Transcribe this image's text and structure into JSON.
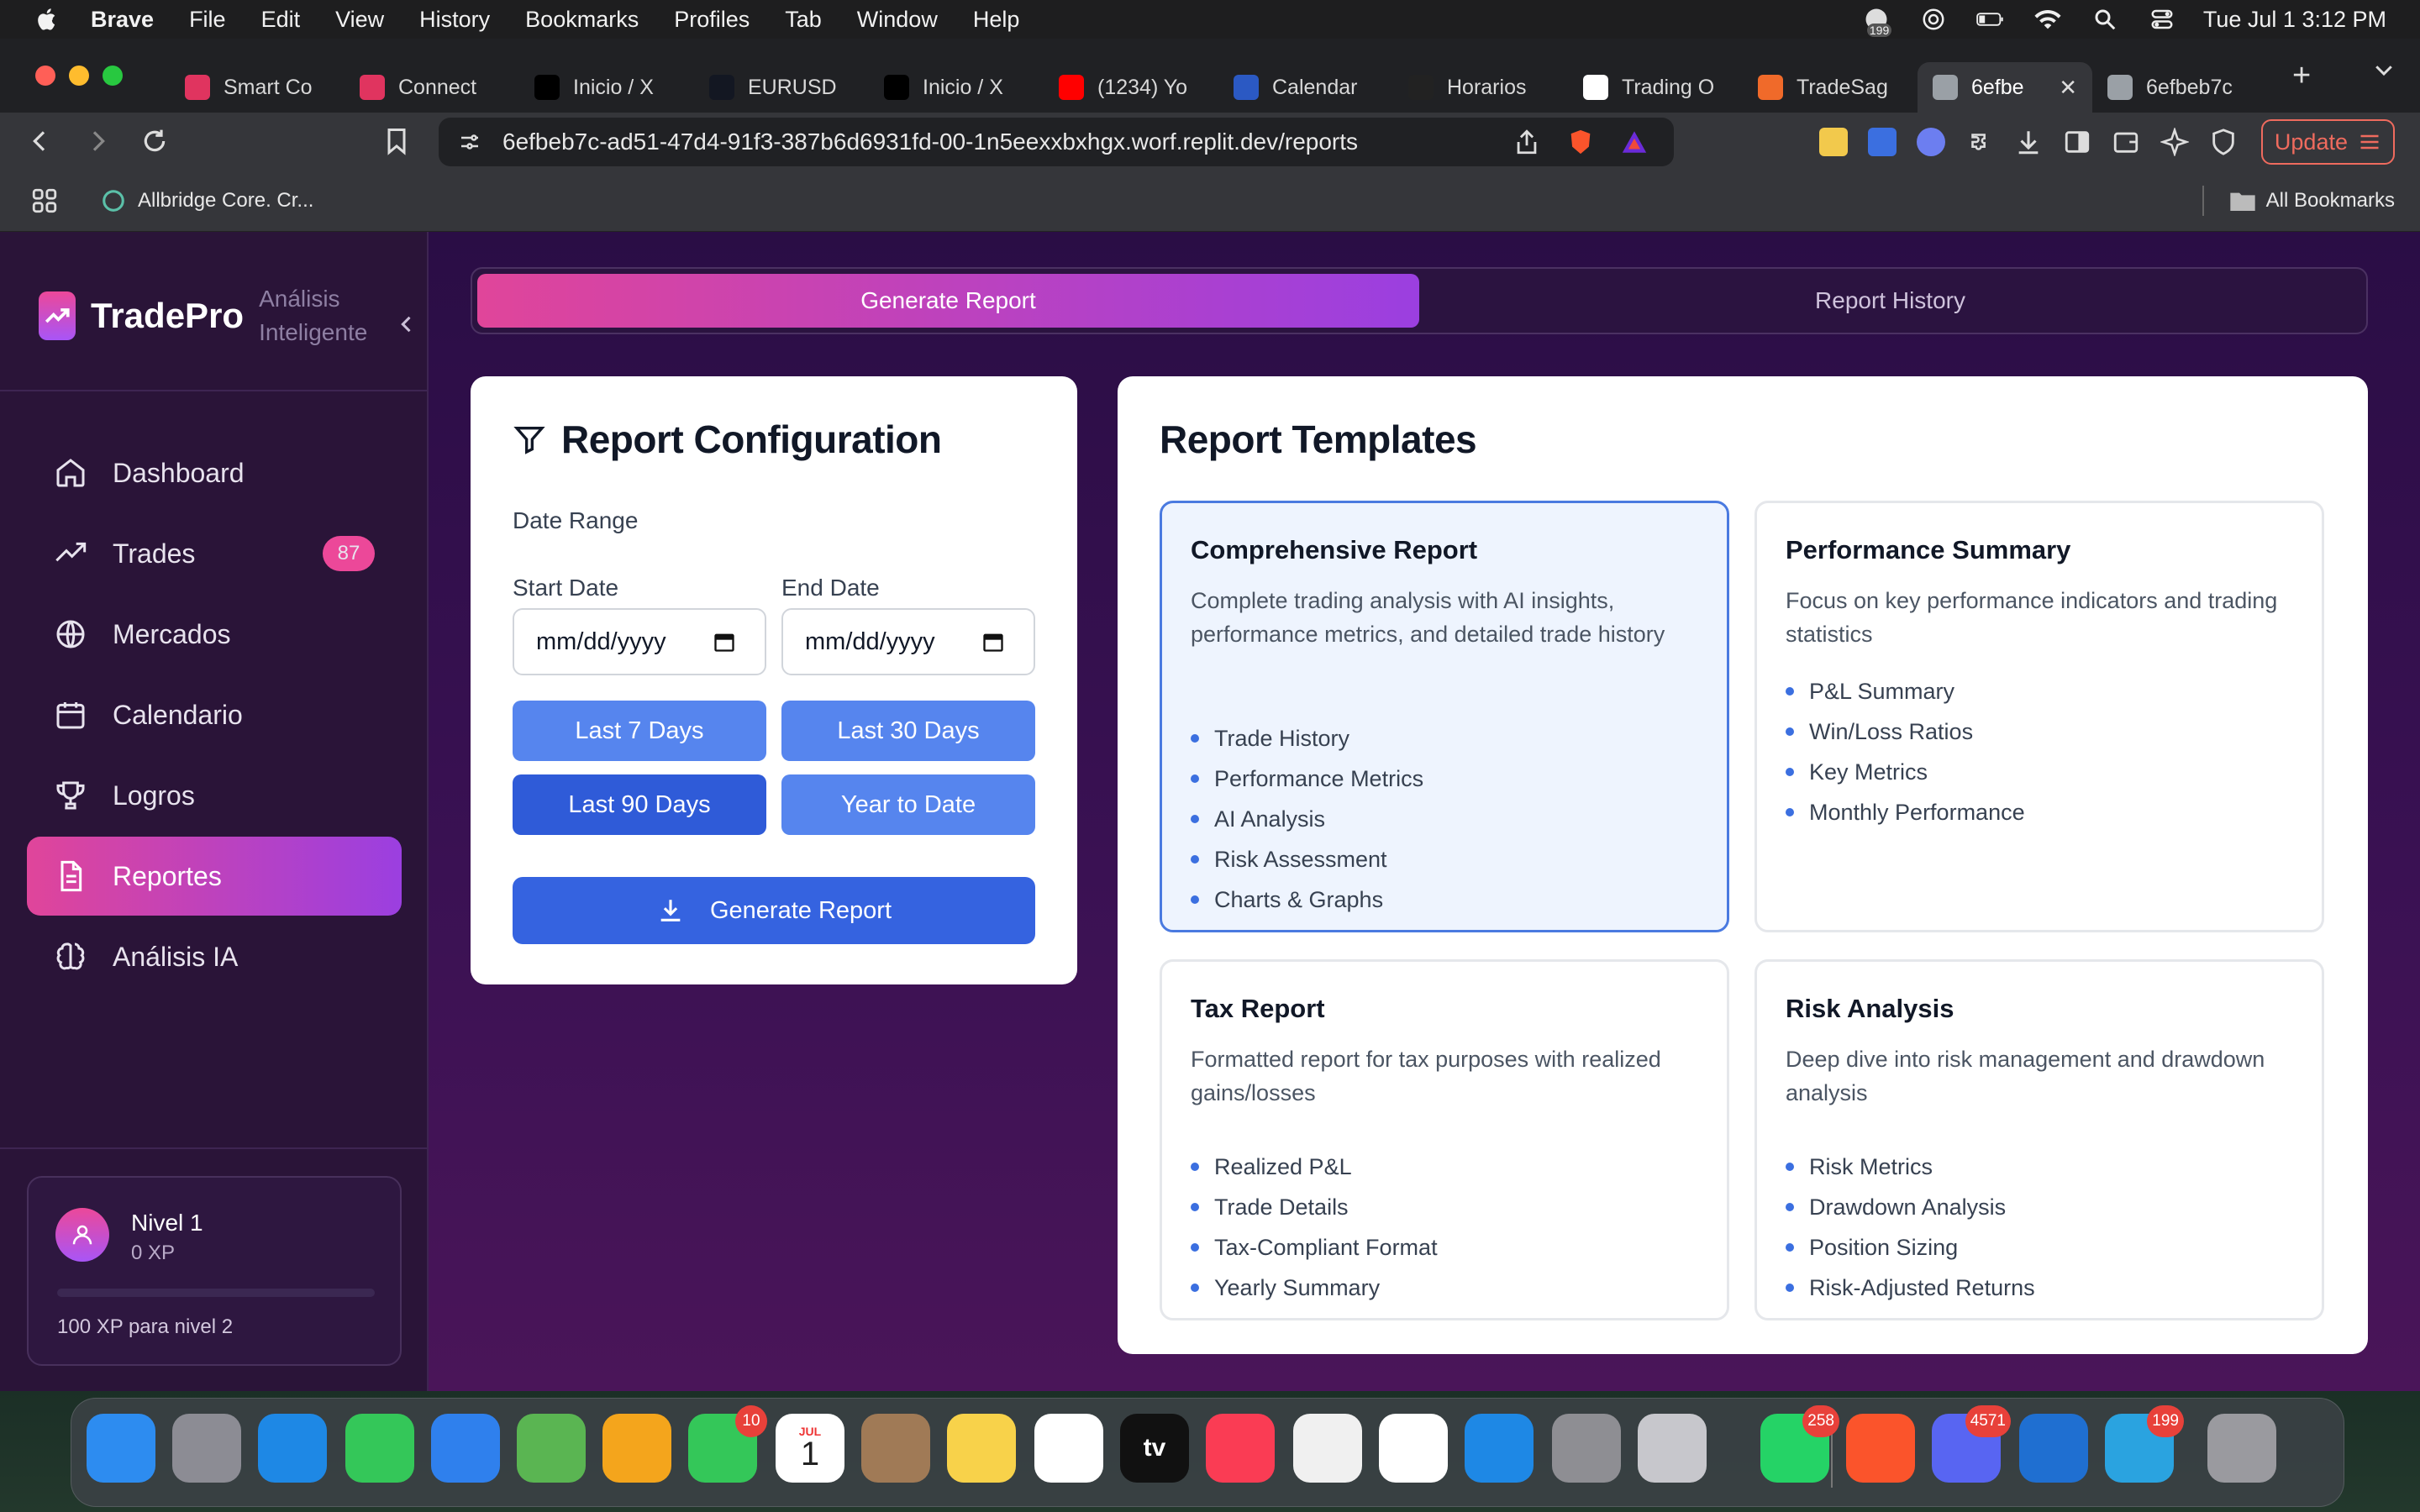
{
  "menubar": {
    "app_name": "Brave",
    "items": [
      "File",
      "Edit",
      "View",
      "History",
      "Bookmarks",
      "Profiles",
      "Tab",
      "Window",
      "Help"
    ],
    "mail_badge": "199",
    "clock": "Tue Jul 1  3:12 PM"
  },
  "browser": {
    "tabs": [
      {
        "label": "Smart Co",
        "favicon": "loop-icon",
        "color": "#e0345f"
      },
      {
        "label": "Connect",
        "favicon": "loop-icon",
        "color": "#e0345f"
      },
      {
        "label": "Inicio / X",
        "favicon": "x-logo-icon",
        "color": "#000000"
      },
      {
        "label": "EURUSD",
        "favicon": "tradingview-icon",
        "color": "#131722"
      },
      {
        "label": "Inicio / X",
        "favicon": "x-logo-icon",
        "color": "#000000"
      },
      {
        "label": "(1234) Yo",
        "favicon": "youtube-icon",
        "color": "#ff0000"
      },
      {
        "label": "Calendar",
        "favicon": "calendar-icon",
        "color": "#2b59c3"
      },
      {
        "label": "Horarios",
        "favicon": "investing-icon",
        "color": "#222222"
      },
      {
        "label": "Trading O",
        "favicon": "fn-icon",
        "color": "#ffffff"
      },
      {
        "label": "TradeSag",
        "favicon": "tradesage-icon",
        "color": "#f06a2a"
      },
      {
        "label": "6efbe",
        "favicon": "globe-icon",
        "color": "#9aa0a6",
        "active": true
      },
      {
        "label": "6efbeb7c",
        "favicon": "globe-icon",
        "color": "#9aa0a6"
      }
    ],
    "url": "6efbeb7c-ad51-47d4-91f3-387b6d6931fd-00-1n5eexxbxhgx.worf.replit.dev/reports",
    "update_label": "Update",
    "bookmarks": [
      {
        "label": "Allbridge Core. Cr..."
      }
    ],
    "all_bookmarks_label": "All Bookmarks"
  },
  "sidebar": {
    "brand": "TradePro",
    "brand_sub_line1": "Análisis",
    "brand_sub_line2": "Inteligente",
    "items": [
      {
        "label": "Dashboard",
        "icon": "home-icon"
      },
      {
        "label": "Trades",
        "icon": "trending-up-icon",
        "badge": "87"
      },
      {
        "label": "Mercados",
        "icon": "globe-icon"
      },
      {
        "label": "Calendario",
        "icon": "calendar-icon"
      },
      {
        "label": "Logros",
        "icon": "trophy-icon"
      },
      {
        "label": "Reportes",
        "icon": "file-text-icon",
        "active": true
      },
      {
        "label": "Análisis IA",
        "icon": "brain-icon"
      }
    ],
    "level": {
      "title": "Nivel 1",
      "xp": "0 XP",
      "progress": 0,
      "next": "100 XP para nivel 2"
    }
  },
  "main": {
    "tabs": [
      {
        "label": "Generate Report",
        "active": true
      },
      {
        "label": "Report History"
      }
    ],
    "config": {
      "title": "Report Configuration",
      "date_range_label": "Date Range",
      "start_label": "Start Date",
      "end_label": "End Date",
      "start_value": "mm/dd/yyyy",
      "end_value": "mm/dd/yyyy",
      "quick": [
        "Last 7 Days",
        "Last 30 Days",
        "Last 90 Days",
        "Year to Date"
      ],
      "generate_label": "Generate Report"
    },
    "templates": {
      "title": "Report Templates",
      "items": [
        {
          "name": "Comprehensive Report",
          "desc": "Complete trading analysis with AI insights, performance metrics, and detailed trade history",
          "features": [
            "Trade History",
            "Performance Metrics",
            "AI Analysis",
            "Risk Assessment",
            "Charts & Graphs"
          ],
          "selected": true
        },
        {
          "name": "Performance Summary",
          "desc": "Focus on key performance indicators and trading statistics",
          "features": [
            "P&L Summary",
            "Win/Loss Ratios",
            "Key Metrics",
            "Monthly Performance"
          ]
        },
        {
          "name": "Tax Report",
          "desc": "Formatted report for tax purposes with realized gains/losses",
          "features": [
            "Realized P&L",
            "Trade Details",
            "Tax-Compliant Format",
            "Yearly Summary"
          ]
        },
        {
          "name": "Risk Analysis",
          "desc": "Deep dive into risk management and drawdown analysis",
          "features": [
            "Risk Metrics",
            "Drawdown Analysis",
            "Position Sizing",
            "Risk-Adjusted Returns"
          ]
        }
      ]
    }
  },
  "dock": {
    "items": [
      {
        "name": "finder-icon",
        "color": "#2d8cf0"
      },
      {
        "name": "launchpad-icon",
        "color": "#8c8c94"
      },
      {
        "name": "safari-icon",
        "color": "#1e88e5"
      },
      {
        "name": "messages-icon",
        "color": "#34c759"
      },
      {
        "name": "mail-icon",
        "color": "#2f80ed"
      },
      {
        "name": "maps-icon",
        "color": "#5ab552"
      },
      {
        "name": "photos-icon",
        "color": "#f4a51c"
      },
      {
        "name": "facetime-icon",
        "color": "#34c759",
        "badge": "10"
      },
      {
        "name": "calendar-app-icon",
        "color": "#ffffff",
        "text": "1",
        "month": "JUL"
      },
      {
        "name": "contacts-icon",
        "color": "#a07a56"
      },
      {
        "name": "notes-icon",
        "color": "#f8d24a"
      },
      {
        "name": "freeform-icon",
        "color": "#ffffff"
      },
      {
        "name": "apple-tv-icon",
        "color": "#111111",
        "text": "tv"
      },
      {
        "name": "music-icon",
        "color": "#fa3c54"
      },
      {
        "name": "news-icon",
        "color": "#f0f0f0"
      },
      {
        "name": "reminders-icon",
        "color": "#ffffff"
      },
      {
        "name": "app-store-icon",
        "color": "#1e88e5"
      },
      {
        "name": "system-settings-icon",
        "color": "#8e8e93"
      },
      {
        "name": "iphone-mirroring-icon",
        "color": "#c7c7cc"
      },
      {
        "name": "whatsapp-icon",
        "color": "#25d366",
        "badge": "258"
      },
      {
        "name": "brave-icon",
        "color": "#fb542b"
      },
      {
        "name": "discord-icon",
        "color": "#5865f2",
        "badge": "4571"
      },
      {
        "name": "vscode-icon",
        "color": "#1f6fd1"
      },
      {
        "name": "telegram-icon",
        "color": "#2aa3e0",
        "badge": "199"
      },
      {
        "name": "trash-icon",
        "color": "#9a9a9f"
      }
    ]
  }
}
